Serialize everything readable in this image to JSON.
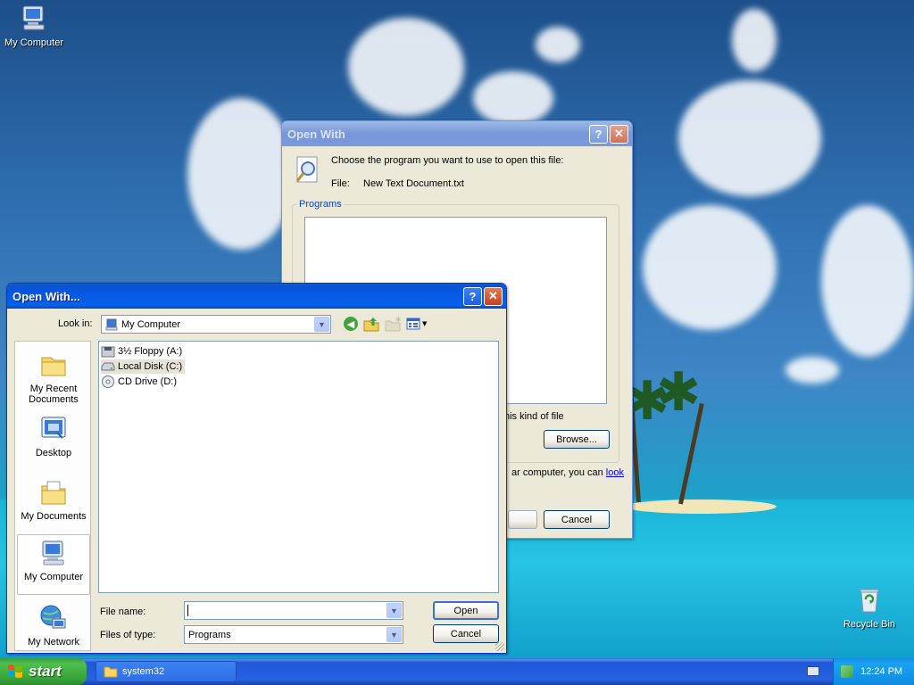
{
  "desktop": {
    "icons": [
      {
        "label": "My Computer"
      },
      {
        "label": "Recycle Bin"
      }
    ]
  },
  "open_with_back": {
    "title": "Open With",
    "prompt": "Choose the program you want to use to open this file:",
    "file_label": "File:",
    "file_name": "New Text Document.txt",
    "programs_group": "Programs",
    "partial_checkbox_text": "his kind of file",
    "browse_button": "Browse...",
    "partial_hint_text": "ar computer, you can",
    "hint_link": "look",
    "cancel_button": "Cancel"
  },
  "open_with_dialog": {
    "title": "Open With...",
    "look_in_label": "Look in:",
    "look_in_value": "My Computer",
    "places": [
      {
        "label": "My Recent Documents",
        "icon": "recent-documents-icon"
      },
      {
        "label": "Desktop",
        "icon": "desktop-icon"
      },
      {
        "label": "My Documents",
        "icon": "my-documents-icon"
      },
      {
        "label": "My Computer",
        "icon": "my-computer-icon",
        "selected": true
      },
      {
        "label": "My Network",
        "icon": "my-network-icon"
      }
    ],
    "drives": [
      {
        "label": "3½ Floppy (A:)",
        "icon": "floppy-drive-icon"
      },
      {
        "label": "Local Disk (C:)",
        "icon": "hard-disk-icon",
        "selected": true
      },
      {
        "label": "CD Drive (D:)",
        "icon": "cd-drive-icon"
      }
    ],
    "file_name_label": "File name:",
    "file_name_value": "",
    "files_of_type_label": "Files of type:",
    "files_of_type_value": "Programs",
    "open_button": "Open",
    "cancel_button": "Cancel"
  },
  "taskbar": {
    "start_label": "start",
    "task_button": "system32",
    "clock": "12:24 PM"
  }
}
